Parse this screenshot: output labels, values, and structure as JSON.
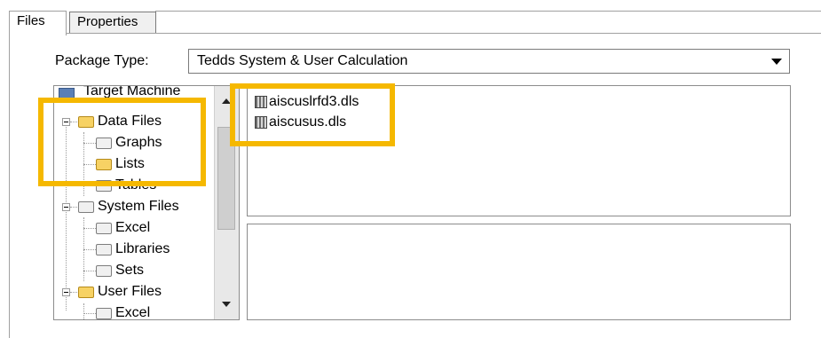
{
  "tabs": [
    {
      "label": "Files",
      "active": true
    },
    {
      "label": "Properties",
      "active": false
    }
  ],
  "package_type": {
    "label": "Package Type:",
    "value": "Tedds System & User Calculation"
  },
  "tree": {
    "items": [
      {
        "label": "Target Machine",
        "icon": "computer-icon"
      },
      {
        "label": "Data Files",
        "icon": "folder-open-icon"
      },
      {
        "label": "Graphs",
        "icon": "folder-icon"
      },
      {
        "label": "Lists",
        "icon": "folder-open-icon",
        "selected": true
      },
      {
        "label": "Tables",
        "icon": "folder-icon"
      },
      {
        "label": "System Files",
        "icon": "folder-icon"
      },
      {
        "label": "Excel",
        "icon": "folder-icon"
      },
      {
        "label": "Libraries",
        "icon": "folder-icon"
      },
      {
        "label": "Sets",
        "icon": "folder-icon"
      },
      {
        "label": "User Files",
        "icon": "folder-open-icon"
      },
      {
        "label": "Excel",
        "icon": "folder-icon"
      }
    ]
  },
  "files": [
    {
      "name": "aiscuslrfd3.dls",
      "icon": "data-file-icon"
    },
    {
      "name": "aiscusus.dls",
      "icon": "data-file-icon"
    }
  ],
  "colors": {
    "highlight": "#f5b800",
    "folder_yellow": "#f3c64d"
  }
}
